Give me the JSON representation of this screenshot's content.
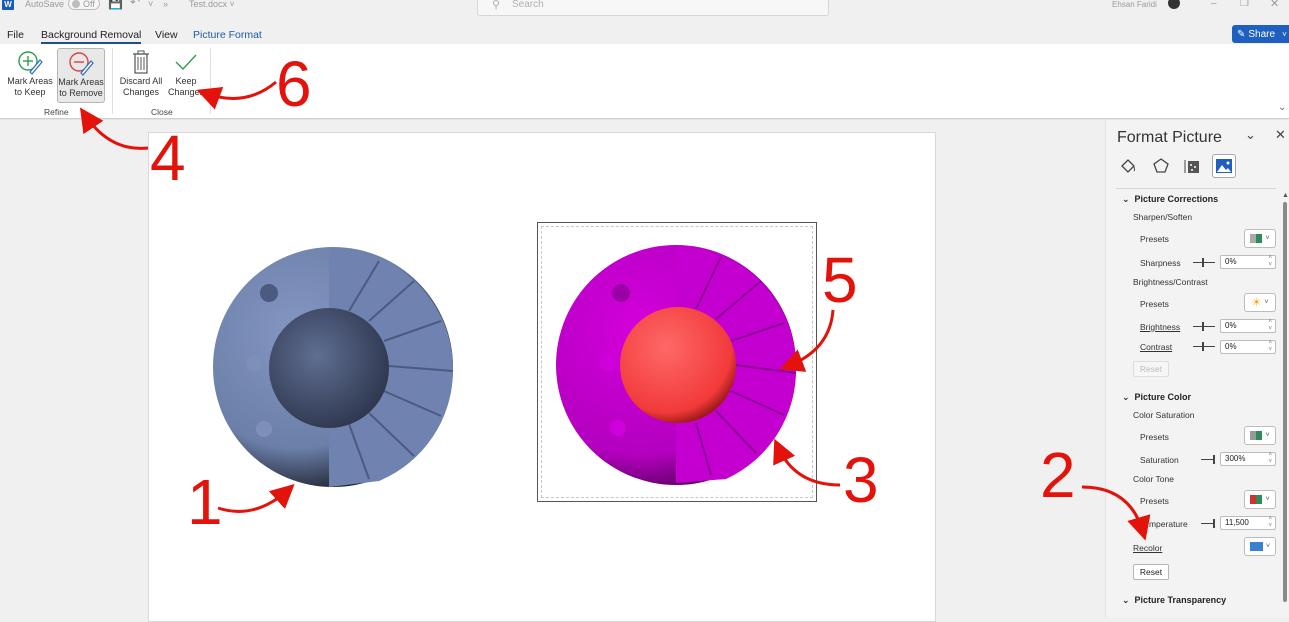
{
  "titlebar": {
    "app_icon": "word-icon",
    "app_letter": "W",
    "autosave_label": "AutoSave",
    "autosave_state": "Off",
    "filename": "Test.docx",
    "search_placeholder": "Search",
    "user_name": "Ehsan Faridi"
  },
  "menu": {
    "tabs": [
      {
        "label": "File"
      },
      {
        "label": "Background Removal",
        "active": true
      },
      {
        "label": "View"
      },
      {
        "label": "Picture Format"
      }
    ],
    "share_label": "Share"
  },
  "ribbon": {
    "groups": [
      {
        "label": "Refine",
        "buttons": [
          {
            "label_line1": "Mark Areas",
            "label_line2": "to Keep",
            "icon": "mark-keep-icon"
          },
          {
            "label_line1": "Mark Areas",
            "label_line2": "to Remove",
            "icon": "mark-remove-icon",
            "pressed": true
          }
        ]
      },
      {
        "label": "Close",
        "buttons": [
          {
            "label_line1": "Discard All",
            "label_line2": "Changes",
            "icon": "trash-icon"
          },
          {
            "label_line1": "Keep",
            "label_line2": "Changes",
            "icon": "checkmark-icon"
          }
        ]
      }
    ]
  },
  "annotations": [
    "1",
    "2",
    "3",
    "4",
    "5",
    "6"
  ],
  "colors": {
    "accent": "#1f5fbf",
    "annotation_red": "#e3120b",
    "original_object": "#6b7fa8",
    "recolored_object": "#c800d0",
    "inner_sphere": "#ff4a4a"
  },
  "format_pane": {
    "title": "Format Picture",
    "tabs": [
      "fill-line-icon",
      "effects-icon",
      "size-properties-icon",
      "picture-icon"
    ],
    "sections": {
      "corrections": {
        "title": "Picture Corrections",
        "sharpen_label": "Sharpen/Soften",
        "presets_label": "Presets",
        "sharpness_label": "Sharpness",
        "sharpness_value": "0%",
        "bc_label": "Brightness/Contrast",
        "presets2_label": "Presets",
        "brightness_label": "Brightness",
        "brightness_value": "0%",
        "contrast_label": "Contrast",
        "contrast_value": "0%",
        "reset_label": "Reset"
      },
      "color": {
        "title": "Picture Color",
        "saturation_group": "Color Saturation",
        "presets_label": "Presets",
        "saturation_label": "Saturation",
        "saturation_value": "300%",
        "tone_group": "Color Tone",
        "presets2_label": "Presets",
        "temperature_label": "Temperature",
        "temperature_value": "11,500",
        "recolor_label": "Recolor",
        "reset_label": "Reset"
      },
      "transparency": {
        "title": "Picture Transparency"
      }
    }
  }
}
